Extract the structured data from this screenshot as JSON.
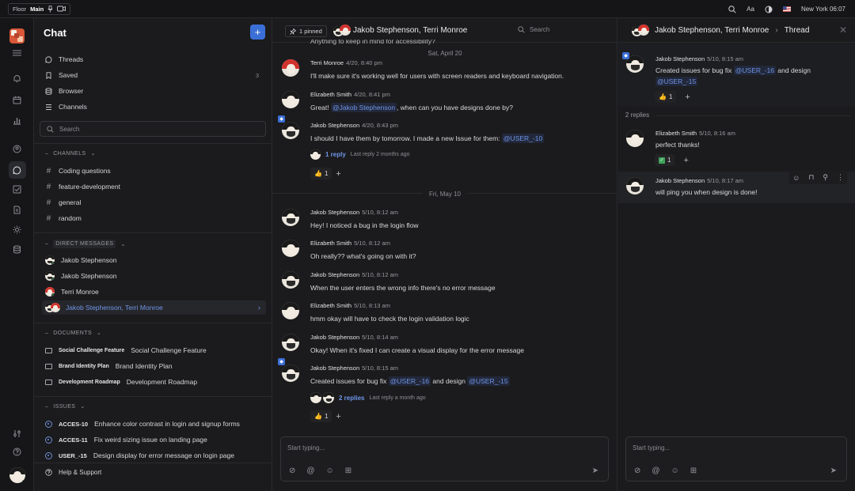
{
  "topbar": {
    "floor_label": "Floor",
    "floor_value": "Main",
    "font_label": "Aa",
    "location": "New York",
    "time": "06:07"
  },
  "sidebar": {
    "title": "Chat",
    "nav": [
      {
        "label": "Threads",
        "icon": "threads-icon",
        "count": ""
      },
      {
        "label": "Saved",
        "icon": "bookmark-icon",
        "count": "3"
      },
      {
        "label": "Browser",
        "icon": "browser-icon",
        "count": ""
      },
      {
        "label": "Channels",
        "icon": "channels-icon",
        "count": ""
      }
    ],
    "search_placeholder": "Search",
    "channels_header": "CHANNELS",
    "channels": [
      "Coding questions",
      "feature-development",
      "general",
      "random"
    ],
    "dm_header": "DIRECT MESSAGES",
    "dms": [
      "Jakob Stephenson",
      "Jakob Stephenson",
      "Terri Monroe",
      "Jakob Stephenson, Terri Monroe"
    ],
    "documents_header": "DOCUMENTS",
    "documents": [
      {
        "tag": "Social Challenge Feature",
        "name": "Social Challenge Feature"
      },
      {
        "tag": "Brand Identity Plan",
        "name": "Brand Identity Plan"
      },
      {
        "tag": "Development Roadmap",
        "name": "Development Roadmap"
      }
    ],
    "issues_header": "ISSUES",
    "issues": [
      {
        "id": "ACCES-10",
        "title": "Enhance color contrast in login and signup forms"
      },
      {
        "id": "ACCES-11",
        "title": "Fix weird sizing issue on landing page"
      },
      {
        "id": "USER_-15",
        "title": "Design display for error message on login page"
      }
    ],
    "help": "Help & Support"
  },
  "main": {
    "pinned": "1 pinned",
    "title": "Jakob Stephenson, Terri Monroe",
    "search": "Search",
    "top_cut_text": "Anything to keep in mind for accessibility?",
    "date1": "Sat, April 20",
    "date2": "Fri, May 10",
    "messages": [
      {
        "name": "Terri Monroe",
        "time": "4/20, 8:40 pm",
        "text": "I'll make sure it's working well for users with screen readers and keyboard navigation."
      },
      {
        "name": "Elizabeth Smith",
        "time": "4/20, 8:41 pm",
        "pre": "Great!",
        "mention": "@Jakob Stephenson",
        "post": ", when can you have designs done by?"
      },
      {
        "name": "Jakob Stephenson",
        "time": "4/20, 8:43 pm",
        "pre": "I should I have them by tomorrow. I made a new Issue for them:",
        "mention": "@USER_-10",
        "reply": "1 reply",
        "last": "Last reply 2 months ago",
        "reaction": "1"
      },
      {
        "name": "Jakob Stephenson",
        "time": "5/10, 8:12 am",
        "text": "Hey! I noticed a bug in the login flow"
      },
      {
        "name": "Elizabeth Smith",
        "time": "5/10, 8:12 am",
        "text": "Oh really?? what's going on with it?"
      },
      {
        "name": "Jakob Stephenson",
        "time": "5/10, 8:12 am",
        "text": "When the user enters the wrong info there's no error message"
      },
      {
        "name": "Elizabeth Smith",
        "time": "5/10, 8:13 am",
        "text": "hmm okay will have to check the login validation logic"
      },
      {
        "name": "Jakob Stephenson",
        "time": "5/10, 8:14 am",
        "text": "Okay! When it's fixed I can create a visual display for the error message"
      },
      {
        "name": "Jakob Stephenson",
        "time": "5/10, 8:15 am",
        "pre": "Created issues for bug fix",
        "mention": "@USER_-16",
        "mid": "and design",
        "mention2": "@USER_-15",
        "reply": "2 replies",
        "last": "Last reply a month ago",
        "reaction": "1"
      }
    ],
    "composer_placeholder": "Start typing..."
  },
  "thread": {
    "title": "Jakob Stephenson, Terri Monroe",
    "crumb": "Thread",
    "replies_label": "2 replies",
    "root": {
      "name": "Jakob Stephenson",
      "time": "5/10, 8:15 am",
      "pre": "Created issues for bug fix",
      "mention": "@USER_-16",
      "mid": "and design",
      "mention2": "@USER_-15",
      "reaction": "1"
    },
    "replies": [
      {
        "name": "Elizabeth Smith",
        "time": "5/10, 8:16 am",
        "text": "perfect thanks!",
        "reaction": "1"
      },
      {
        "name": "Jakob Stephenson",
        "time": "5/10, 8:17 am",
        "text": "will ping you when design is done!"
      }
    ],
    "composer_placeholder": "Start typing..."
  },
  "colors": {
    "accent": "#3b6fd8",
    "mention": "#6f95e8",
    "background": "#1b1b1d",
    "online": "#3fa45b"
  }
}
